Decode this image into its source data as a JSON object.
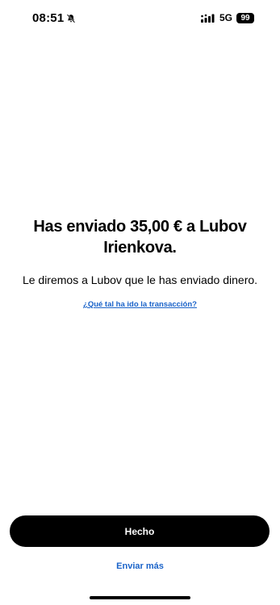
{
  "status_bar": {
    "time": "08:51",
    "network": "5G",
    "battery": "99",
    "icons": [
      "bell-slash-icon",
      "signal-bars-icon"
    ]
  },
  "confirmation": {
    "headline": "Has enviado 35,00 € a Lubov Irienkova.",
    "message": "Le diremos a Lubov que le has enviado dinero.",
    "feedback_link": "¿Qué tal ha ido la transacción?"
  },
  "actions": {
    "done_label": "Hecho",
    "send_more_label": "Enviar más"
  },
  "colors": {
    "link": "#1a63c9",
    "primary_button": "#000000",
    "background": "#ffffff"
  }
}
